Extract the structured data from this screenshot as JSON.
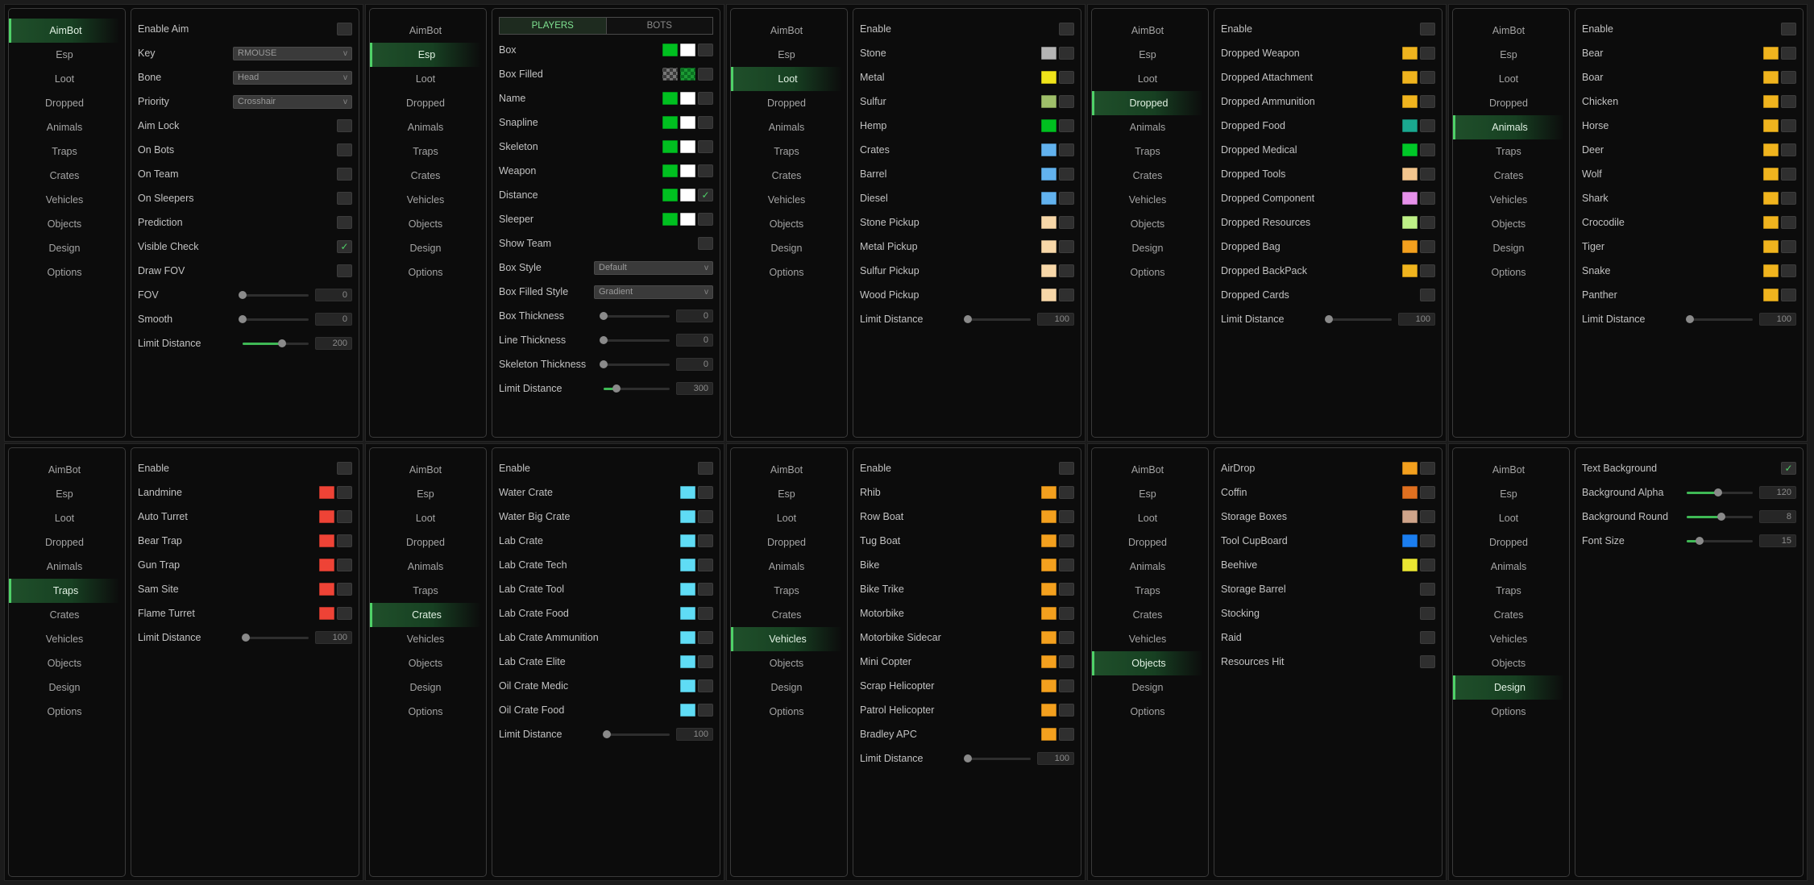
{
  "nav": [
    "AimBot",
    "Esp",
    "Loot",
    "Dropped",
    "Animals",
    "Traps",
    "Crates",
    "Vehicles",
    "Objects",
    "Design",
    "Options"
  ],
  "colors": {
    "accent": "#4fd168",
    "green": "#00c020",
    "white": "#ffffff",
    "gray": "#b5b5b5",
    "yellow": "#f0e41a",
    "olive": "#9fbf6a",
    "blue": "#62b2ee",
    "peach": "#f7d7a8",
    "gold": "#f0b41e",
    "teal": "#1aa890",
    "lgreen": "#00c828",
    "tan": "#f3c58d",
    "pink": "#e691ea",
    "lime": "#bff087",
    "orange": "#f3a01e",
    "red": "#ee4336",
    "cyan": "#5fdcf5",
    "rust": "#e07020",
    "beige": "#cfa48a",
    "bluedark": "#1b7ef0",
    "lemon": "#eae632"
  },
  "panels": [
    {
      "active": "AimBot",
      "items": [
        {
          "type": "check",
          "label": "Enable Aim"
        },
        {
          "type": "dropdown",
          "label": "Key",
          "value": "RMOUSE"
        },
        {
          "type": "dropdown",
          "label": "Bone",
          "value": "Head"
        },
        {
          "type": "dropdown",
          "label": "Priority",
          "value": "Crosshair"
        },
        {
          "type": "check",
          "label": "Aim Lock"
        },
        {
          "type": "check",
          "label": "On Bots"
        },
        {
          "type": "check",
          "label": "On Team"
        },
        {
          "type": "check",
          "label": "On Sleepers"
        },
        {
          "type": "check",
          "label": "Prediction"
        },
        {
          "type": "check",
          "label": "Visible Check",
          "checked": true
        },
        {
          "type": "check",
          "label": "Draw FOV"
        },
        {
          "type": "slider",
          "label": "FOV",
          "value": "0",
          "level": 0
        },
        {
          "type": "slider",
          "label": "Smooth",
          "value": "0",
          "level": 0
        },
        {
          "type": "slider",
          "label": "Limit Distance",
          "value": "200",
          "level": 0.6
        }
      ]
    },
    {
      "active": "Esp",
      "tabs": [
        "PLAYERS",
        "BOTS"
      ],
      "items": [
        {
          "type": "color",
          "label": "Box",
          "colors": [
            "green",
            "white"
          ]
        },
        {
          "type": "color",
          "label": "Box Filled",
          "colors": [
            "checker",
            "gchecker"
          ]
        },
        {
          "type": "color",
          "label": "Name",
          "colors": [
            "green",
            "white"
          ]
        },
        {
          "type": "color",
          "label": "Snapline",
          "colors": [
            "green",
            "white"
          ]
        },
        {
          "type": "color",
          "label": "Skeleton",
          "colors": [
            "green",
            "white"
          ]
        },
        {
          "type": "color",
          "label": "Weapon",
          "colors": [
            "green",
            "white"
          ]
        },
        {
          "type": "color",
          "label": "Distance",
          "colors": [
            "green",
            "white"
          ],
          "checked": true
        },
        {
          "type": "color",
          "label": "Sleeper",
          "colors": [
            "green",
            "white"
          ]
        },
        {
          "type": "check",
          "label": "Show Team"
        },
        {
          "type": "dropdown",
          "label": "Box Style",
          "value": "Default"
        },
        {
          "type": "dropdown",
          "label": "Box Filled Style",
          "value": "Gradient"
        },
        {
          "type": "slider",
          "label": "Box Thickness",
          "value": "0",
          "level": 0
        },
        {
          "type": "slider",
          "label": "Line Thickness",
          "value": "0",
          "level": 0
        },
        {
          "type": "slider",
          "label": "Skeleton Thickness",
          "value": "0",
          "level": 0
        },
        {
          "type": "slider",
          "label": "Limit Distance",
          "value": "300",
          "level": 0.2
        }
      ]
    },
    {
      "active": "Loot",
      "items": [
        {
          "type": "check",
          "label": "Enable"
        },
        {
          "type": "color",
          "label": "Stone",
          "colors": [
            "gray"
          ]
        },
        {
          "type": "color",
          "label": "Metal",
          "colors": [
            "yellow"
          ]
        },
        {
          "type": "color",
          "label": "Sulfur",
          "colors": [
            "olive"
          ]
        },
        {
          "type": "color",
          "label": "Hemp",
          "colors": [
            "green"
          ]
        },
        {
          "type": "color",
          "label": "Crates",
          "colors": [
            "blue"
          ]
        },
        {
          "type": "color",
          "label": "Barrel",
          "colors": [
            "blue"
          ]
        },
        {
          "type": "color",
          "label": "Diesel",
          "colors": [
            "blue"
          ]
        },
        {
          "type": "color",
          "label": "Stone Pickup",
          "colors": [
            "peach"
          ]
        },
        {
          "type": "color",
          "label": "Metal Pickup",
          "colors": [
            "peach"
          ]
        },
        {
          "type": "color",
          "label": "Sulfur Pickup",
          "colors": [
            "peach"
          ]
        },
        {
          "type": "color",
          "label": "Wood Pickup",
          "colors": [
            "peach"
          ]
        },
        {
          "type": "slider",
          "label": "Limit Distance",
          "value": "100",
          "level": 0.05
        }
      ]
    },
    {
      "active": "Dropped",
      "items": [
        {
          "type": "check",
          "label": "Enable"
        },
        {
          "type": "color",
          "label": "Dropped Weapon",
          "colors": [
            "gold"
          ]
        },
        {
          "type": "color",
          "label": "Dropped Attachment",
          "colors": [
            "gold"
          ]
        },
        {
          "type": "color",
          "label": "Dropped Ammunition",
          "colors": [
            "gold"
          ]
        },
        {
          "type": "color",
          "label": "Dropped Food",
          "colors": [
            "teal"
          ]
        },
        {
          "type": "color",
          "label": "Dropped Medical",
          "colors": [
            "lgreen"
          ]
        },
        {
          "type": "color",
          "label": "Dropped Tools",
          "colors": [
            "tan"
          ]
        },
        {
          "type": "color",
          "label": "Dropped Component",
          "colors": [
            "pink"
          ]
        },
        {
          "type": "color",
          "label": "Dropped Resources",
          "colors": [
            "lime"
          ]
        },
        {
          "type": "color",
          "label": "Dropped Bag",
          "colors": [
            "orange"
          ]
        },
        {
          "type": "color",
          "label": "Dropped BackPack",
          "colors": [
            "gold"
          ]
        },
        {
          "type": "check",
          "label": "Dropped Cards"
        },
        {
          "type": "slider",
          "label": "Limit Distance",
          "value": "100",
          "level": 0.05
        }
      ]
    },
    {
      "active": "Animals",
      "items": [
        {
          "type": "check",
          "label": "Enable"
        },
        {
          "type": "color",
          "label": "Bear",
          "colors": [
            "gold"
          ]
        },
        {
          "type": "color",
          "label": "Boar",
          "colors": [
            "gold"
          ]
        },
        {
          "type": "color",
          "label": "Chicken",
          "colors": [
            "gold"
          ]
        },
        {
          "type": "color",
          "label": "Horse",
          "colors": [
            "gold"
          ]
        },
        {
          "type": "color",
          "label": "Deer",
          "colors": [
            "gold"
          ]
        },
        {
          "type": "color",
          "label": "Wolf",
          "colors": [
            "gold"
          ]
        },
        {
          "type": "color",
          "label": "Shark",
          "colors": [
            "gold"
          ]
        },
        {
          "type": "color",
          "label": "Crocodile",
          "colors": [
            "gold"
          ]
        },
        {
          "type": "color",
          "label": "Tiger",
          "colors": [
            "gold"
          ]
        },
        {
          "type": "color",
          "label": "Snake",
          "colors": [
            "gold"
          ]
        },
        {
          "type": "color",
          "label": "Panther",
          "colors": [
            "gold"
          ]
        },
        {
          "type": "slider",
          "label": "Limit Distance",
          "value": "100",
          "level": 0.05
        }
      ]
    },
    {
      "active": "Traps",
      "items": [
        {
          "type": "check",
          "label": "Enable"
        },
        {
          "type": "color",
          "label": "Landmine",
          "colors": [
            "red"
          ]
        },
        {
          "type": "color",
          "label": "Auto Turret",
          "colors": [
            "red"
          ]
        },
        {
          "type": "color",
          "label": "Bear Trap",
          "colors": [
            "red"
          ]
        },
        {
          "type": "color",
          "label": "Gun Trap",
          "colors": [
            "red"
          ]
        },
        {
          "type": "color",
          "label": "Sam Site",
          "colors": [
            "red"
          ]
        },
        {
          "type": "color",
          "label": "Flame Turret",
          "colors": [
            "red"
          ]
        },
        {
          "type": "slider",
          "label": "Limit Distance",
          "value": "100",
          "level": 0.05
        }
      ]
    },
    {
      "active": "Crates",
      "items": [
        {
          "type": "check",
          "label": "Enable"
        },
        {
          "type": "color",
          "label": "Water Crate",
          "colors": [
            "cyan"
          ]
        },
        {
          "type": "color",
          "label": "Water Big Crate",
          "colors": [
            "cyan"
          ]
        },
        {
          "type": "color",
          "label": "Lab Crate",
          "colors": [
            "cyan"
          ]
        },
        {
          "type": "color",
          "label": "Lab Crate Tech",
          "colors": [
            "cyan"
          ]
        },
        {
          "type": "color",
          "label": "Lab Crate Tool",
          "colors": [
            "cyan"
          ]
        },
        {
          "type": "color",
          "label": "Lab Crate Food",
          "colors": [
            "cyan"
          ]
        },
        {
          "type": "color",
          "label": "Lab Crate Ammunition",
          "colors": [
            "cyan"
          ]
        },
        {
          "type": "color",
          "label": "Lab Crate Elite",
          "colors": [
            "cyan"
          ]
        },
        {
          "type": "color",
          "label": "Oil Crate Medic",
          "colors": [
            "cyan"
          ]
        },
        {
          "type": "color",
          "label": "Oil Crate Food",
          "colors": [
            "cyan"
          ]
        },
        {
          "type": "slider",
          "label": "Limit Distance",
          "value": "100",
          "level": 0.05
        }
      ]
    },
    {
      "active": "Vehicles",
      "items": [
        {
          "type": "check",
          "label": "Enable"
        },
        {
          "type": "color",
          "label": "Rhib",
          "colors": [
            "orange"
          ]
        },
        {
          "type": "color",
          "label": "Row Boat",
          "colors": [
            "orange"
          ]
        },
        {
          "type": "color",
          "label": "Tug Boat",
          "colors": [
            "orange"
          ]
        },
        {
          "type": "color",
          "label": "Bike",
          "colors": [
            "orange"
          ]
        },
        {
          "type": "color",
          "label": "Bike Trike",
          "colors": [
            "orange"
          ]
        },
        {
          "type": "color",
          "label": "Motorbike",
          "colors": [
            "orange"
          ]
        },
        {
          "type": "color",
          "label": "Motorbike Sidecar",
          "colors": [
            "orange"
          ]
        },
        {
          "type": "color",
          "label": "Mini Copter",
          "colors": [
            "orange"
          ]
        },
        {
          "type": "color",
          "label": "Scrap Helicopter",
          "colors": [
            "orange"
          ]
        },
        {
          "type": "color",
          "label": "Patrol Helicopter",
          "colors": [
            "orange"
          ]
        },
        {
          "type": "color",
          "label": "Bradley APC",
          "colors": [
            "orange"
          ]
        },
        {
          "type": "slider",
          "label": "Limit Distance",
          "value": "100",
          "level": 0.05
        }
      ]
    },
    {
      "active": "Objects",
      "items": [
        {
          "type": "color",
          "label": "AirDrop",
          "colors": [
            "orange"
          ]
        },
        {
          "type": "color",
          "label": "Coffin",
          "colors": [
            "rust"
          ]
        },
        {
          "type": "color",
          "label": "Storage Boxes",
          "colors": [
            "beige"
          ]
        },
        {
          "type": "color",
          "label": "Tool CupBoard",
          "colors": [
            "bluedark"
          ]
        },
        {
          "type": "color",
          "label": "Beehive",
          "colors": [
            "lemon"
          ]
        },
        {
          "type": "check",
          "label": "Storage Barrel"
        },
        {
          "type": "check",
          "label": "Stocking"
        },
        {
          "type": "check",
          "label": "Raid"
        },
        {
          "type": "check",
          "label": "Resources Hit"
        }
      ]
    },
    {
      "active": "Design",
      "items": [
        {
          "type": "check",
          "label": "Text Background",
          "checked": true
        },
        {
          "type": "slider",
          "label": "Background Alpha",
          "value": "120",
          "level": 0.47
        },
        {
          "type": "slider",
          "label": "Background Round",
          "value": "8",
          "level": 0.53
        },
        {
          "type": "slider",
          "label": "Font Size",
          "value": "15",
          "level": 0.2
        }
      ]
    }
  ]
}
